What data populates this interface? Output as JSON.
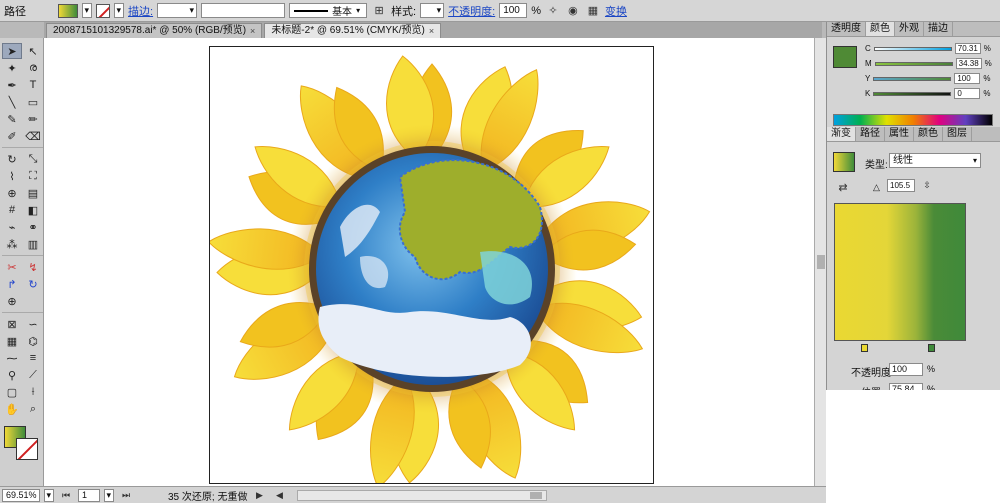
{
  "control_bar": {
    "object_label": "路径",
    "stroke_label": "描边:",
    "stroke_profile": "基本",
    "style_label": "样式:",
    "opacity_label": "不透明度:",
    "opacity_value": "100",
    "opacity_unit": "%",
    "transform_label": "变换"
  },
  "tabs": [
    {
      "label": "20087151013295​78.ai* @ 50% (RGB/预览)",
      "close": "×"
    },
    {
      "label": "未标题-2* @ 69.51% (CMYK/预览)",
      "close": "×"
    }
  ],
  "status_bar": {
    "zoom": "69.51%",
    "page": "1",
    "message": "35 次还原; 无重做"
  },
  "color_panel": {
    "tabs": [
      "透明度",
      "颜色",
      "外观",
      "描边"
    ],
    "active_tab": "颜色",
    "channels": [
      {
        "name": "C",
        "value": "70.31"
      },
      {
        "name": "M",
        "value": "34.38"
      },
      {
        "name": "Y",
        "value": "100"
      },
      {
        "name": "K",
        "value": "0"
      }
    ],
    "swatch_color": "#4f8a35"
  },
  "gradient_panel": {
    "tabs": [
      "渐变",
      "路径",
      "属性",
      "颜色",
      "图层"
    ],
    "active_tab": "渐变",
    "type_label": "类型:",
    "type_value": "线性",
    "angle_value": "105.5",
    "opacity_label": "不透明度:",
    "opacity_value": "100",
    "position_label": "位置:",
    "position_value": "75.84",
    "unit": "%",
    "start_color": "#ead832",
    "end_color": "#3f8a3a"
  },
  "colors": {
    "yellow": "#f2c21f",
    "petal_light": "#f7de3a",
    "earth_blue": "#2f7fc7",
    "earth_green": "#9eae2c",
    "ring_dark": "#5a4228"
  }
}
